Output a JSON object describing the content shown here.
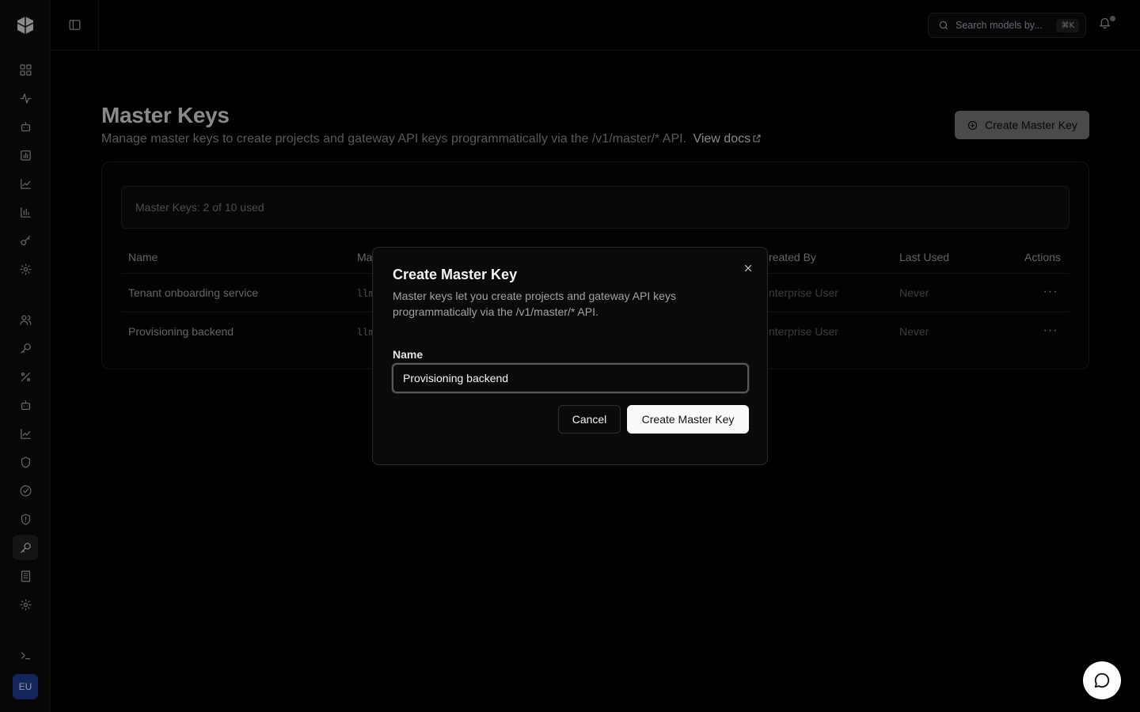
{
  "topbar": {
    "search_placeholder": "Search models by...",
    "search_shortcut": "⌘K"
  },
  "sidebar": {
    "avatar_initials": "EU",
    "active_item": "master-keys"
  },
  "page": {
    "title": "Master Keys",
    "description": "Manage master keys to create projects and gateway API keys programmatically via the /v1/master/* API.",
    "docs_link": "View docs",
    "create_button": "Create Master Key",
    "usage": "Master Keys: 2 of 10 used"
  },
  "table": {
    "columns": {
      "name": "Name",
      "master_key": "Ma",
      "created_by": "reated By",
      "last_used": "Last Used",
      "actions": "Actions"
    },
    "rows": [
      {
        "name": "Tenant onboarding service",
        "key": "llm",
        "created_by": "nterprise User",
        "last_used": "Never"
      },
      {
        "name": "Provisioning backend",
        "key": "llm",
        "created_by": "nterprise User",
        "last_used": "Never"
      }
    ]
  },
  "modal": {
    "title": "Create Master Key",
    "description": "Master keys let you create projects and gateway API keys programmatically via the /v1/master/* API.",
    "name_label": "Name",
    "name_value": "Provisioning backend",
    "cancel_label": "Cancel",
    "submit_label": "Create Master Key"
  }
}
